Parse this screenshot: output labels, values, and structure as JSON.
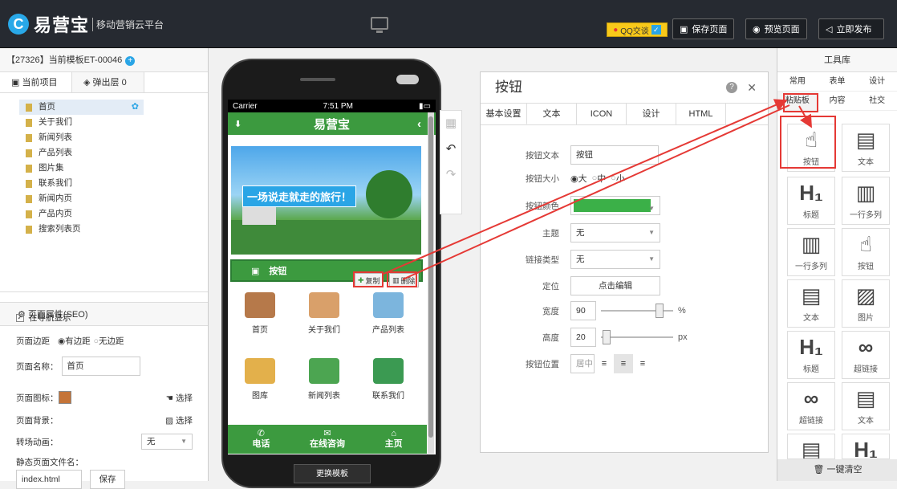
{
  "header": {
    "logo_letter": "C",
    "logo_name": "易营宝",
    "logo_sub": "移动营销云平台",
    "qq_label": "QQ交谈",
    "save_label": "保存页面",
    "preview_label": "预览页面",
    "publish_label": "立即发布"
  },
  "left": {
    "template": "【27326】当前模板ET-00046",
    "tabs": [
      "当前项目",
      "弹出层 0"
    ],
    "pages": [
      "首页",
      "关于我们",
      "新闻列表",
      "产品列表",
      "图片集",
      "联系我们",
      "新闻内页",
      "产品内页",
      "搜索列表页"
    ],
    "seo_title": "页面属性(SEO)",
    "nav_show": "在导航显示",
    "margin_label": "页面边距",
    "margin_opt1": "有边距",
    "margin_opt2": "无边距",
    "name_label": "页面名称：",
    "name_value": "首页",
    "icon_label": "页面图标：",
    "icon_choose": "选择",
    "bg_label": "页面背景：",
    "bg_choose": "选择",
    "anim_label": "转场动画：",
    "anim_value": "无",
    "file_label": "静态页面文件名：",
    "file_value": "index.html",
    "save_btn": "保存"
  },
  "phone": {
    "carrier": "Carrier",
    "time": "7:51 PM",
    "app_title": "易营宝",
    "banner_text": "一场说走就走的旅行！",
    "button_text": "按钮",
    "copy": "复制",
    "delete": "删除",
    "grid": [
      "首页",
      "关于我们",
      "产品列表",
      "图库",
      "新闻列表",
      "联系我们"
    ],
    "footer": [
      "电话",
      "在线咨询",
      "主页"
    ],
    "change_template": "更换模板"
  },
  "dialog": {
    "title": "按钮",
    "tabs": [
      "基本设置",
      "文本",
      "ICON",
      "设计",
      "HTML"
    ],
    "text_label": "按钮文本",
    "text_value": "按钮",
    "size_label": "按钮大小",
    "size_opts": [
      "大",
      "中",
      "小"
    ],
    "color_label": "按钮颜色",
    "theme_label": "主题",
    "theme_value": "无",
    "link_label": "链接类型",
    "link_value": "无",
    "pos_label": "定位",
    "pos_btn": "点击编辑",
    "width_label": "宽度",
    "width_value": "90",
    "width_unit": "%",
    "height_label": "高度",
    "height_value": "20",
    "height_unit": "px",
    "align_label": "按钮位置",
    "align_value": "居中"
  },
  "right": {
    "title": "工具库",
    "tabs_row1": [
      "常用",
      "表单",
      "设计"
    ],
    "tabs_row2": [
      "粘贴板",
      "内容",
      "社交"
    ],
    "tools": [
      "按钮",
      "文本",
      "标题",
      "一行多列",
      "一行多列",
      "按钮",
      "文本",
      "图片",
      "标题",
      "超链接",
      "超链接",
      "文本",
      "文本",
      "标题"
    ],
    "clear": "一键清空"
  },
  "colors": {
    "accent": "#2aa5e6",
    "green": "#3c9a3f",
    "red": "#e53935",
    "topbar": "#262a31"
  }
}
